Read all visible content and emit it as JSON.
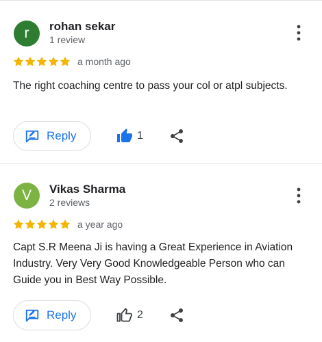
{
  "colors": {
    "star": "#f4b400",
    "accent": "#1a73e8",
    "icon_dark": "#3c4043"
  },
  "reviews": [
    {
      "avatar_letter": "r",
      "avatar_color": "#2e7d32",
      "name": "rohan sekar",
      "review_count": "1 review",
      "rating": 5,
      "date": "a month ago",
      "text": "The right coaching centre to pass your col or atpl subjects.",
      "reply_label": "Reply",
      "like_count": "1",
      "liked": true,
      "icons": [
        "more-vert-icon",
        "star-icon",
        "reply-icon",
        "thumb-up-filled-icon",
        "share-icon"
      ]
    },
    {
      "avatar_letter": "V",
      "avatar_color": "#7cb342",
      "name": "Vikas Sharma",
      "review_count": "2 reviews",
      "rating": 5,
      "date": "a year ago",
      "text": "Capt S.R Meena Ji is having a Great Experience in Aviation Industry. Very Very Good Knowledgeable Person who can Guide you in Best Way Possible.",
      "reply_label": "Reply",
      "like_count": "2",
      "liked": false,
      "icons": [
        "more-vert-icon",
        "star-icon",
        "reply-icon",
        "thumb-up-outline-icon",
        "share-icon"
      ]
    }
  ]
}
